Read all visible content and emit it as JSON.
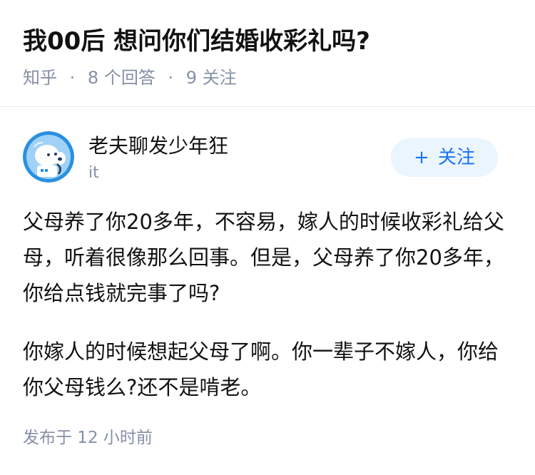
{
  "question": {
    "title": "我00后 想问你们结婚收彩礼吗?",
    "source": "知乎",
    "separator": "·",
    "answer_count": "8 个回答",
    "follower_count": "9 关注"
  },
  "author": {
    "name": "老夫聊发少年狂",
    "headline": "it",
    "avatar_icon": "robot-mascot-avatar"
  },
  "follow_button": {
    "plus": "+",
    "label": "关注"
  },
  "answer": {
    "paragraphs": [
      "父母养了你20多年，不容易，嫁人的时候收彩礼给父母，听着很像那么回事。但是，父母养了你20多年，你给点钱就完事了吗?",
      "你嫁人的时候想起父母了啊。你一辈子不嫁人，你给你父母钱么?还不是啃老。"
    ],
    "published": "发布于 12 小时前"
  },
  "colors": {
    "primary": "#1772f6",
    "follow_bg": "#ebf5fd",
    "meta": "#8590a6",
    "text": "#121212"
  }
}
